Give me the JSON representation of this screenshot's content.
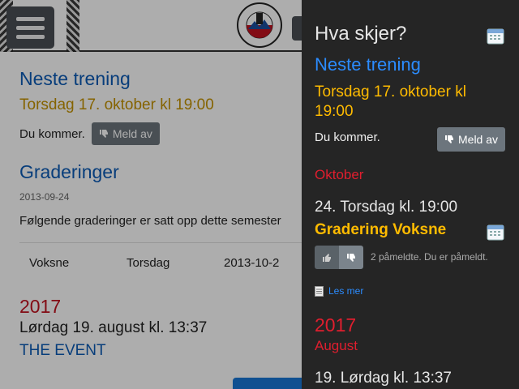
{
  "page": {
    "menu_icon": "hamburger-icon",
    "logo_text": "ROMERIKE JUJUTSU KLUBB",
    "next_training": {
      "heading": "Neste trening",
      "when": "Torsdag 17. oktober kl 19:00",
      "status": "Du kommer.",
      "unsubscribe_label": "Meld av"
    },
    "gradings": {
      "heading": "Graderinger",
      "date": "2013-09-24",
      "intro": "Følgende graderinger er satt opp dette semester",
      "row": [
        "Voksne",
        "Torsdag",
        "2013-10-2"
      ]
    },
    "event": {
      "year": "2017",
      "date": "Lørdag 19. august kl. 13:37",
      "title": "THE EVENT"
    }
  },
  "panel": {
    "title": "Hva skjer?",
    "next_training": {
      "heading": "Neste trening",
      "when": "Torsdag 17. oktober kl 19:00",
      "status": "Du kommer.",
      "unsubscribe_label": "Meld av"
    },
    "october": {
      "month": "Oktober",
      "date": "24. Torsdag kl. 19:00",
      "event_title": "Gradering Voksne",
      "signups": "2 påmeldte. Du er påmeldt.",
      "read_more": "Les mer"
    },
    "next_year": {
      "year": "2017",
      "month": "August",
      "date": "19. Lørdag kl. 13:37"
    }
  },
  "colors": {
    "panel_bg": "#252525",
    "accent_blue": "#2b8cff",
    "accent_gold": "#ffbb00",
    "accent_red": "#e01e2e"
  }
}
